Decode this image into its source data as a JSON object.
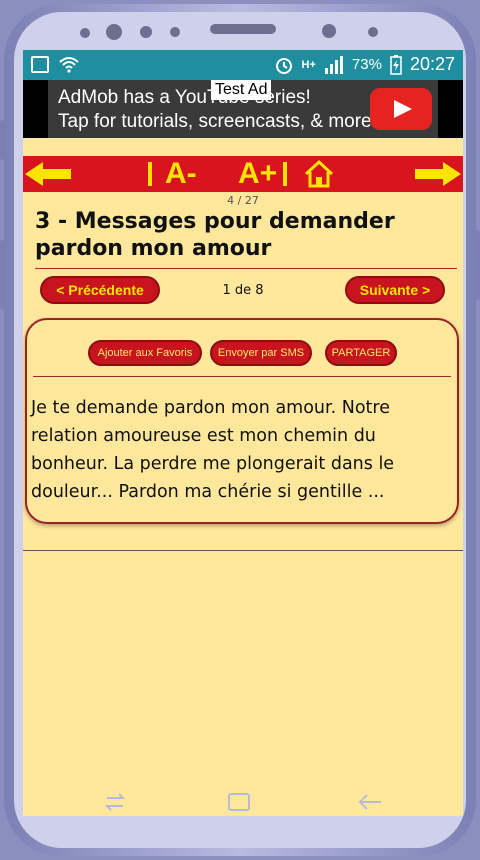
{
  "status_bar": {
    "icons_left": [
      "image-icon",
      "wifi-icon"
    ],
    "network": "H+",
    "battery": "73%",
    "time": "20:27"
  },
  "ad": {
    "label": "Test Ad",
    "line1": "AdMob has a YouTube series!",
    "line2": "Tap for tutorials, screencasts, & more."
  },
  "toolbar": {
    "font_decrease": "A-",
    "font_increase": "A+"
  },
  "counter": "4 / 27",
  "title": "3 - Messages pour demander pardon mon amour",
  "pagination": {
    "prev": "< Précédente",
    "indicator": "1 de 8",
    "next": "Suivante >"
  },
  "actions": {
    "favorites": "Ajouter aux Favoris",
    "sms": "Envoyer par SMS",
    "share": "PARTAGER"
  },
  "message": "Je te demande pardon mon amour. Notre relation amoureuse est mon chemin du bonheur. La perdre me plongerait dans le douleur... Pardon ma chérie si gentille ...",
  "colors": {
    "background": "#ffe79c",
    "accent_red": "#d8141f",
    "accent_yellow": "#ffe400",
    "status_bar": "#1f8fa0"
  }
}
